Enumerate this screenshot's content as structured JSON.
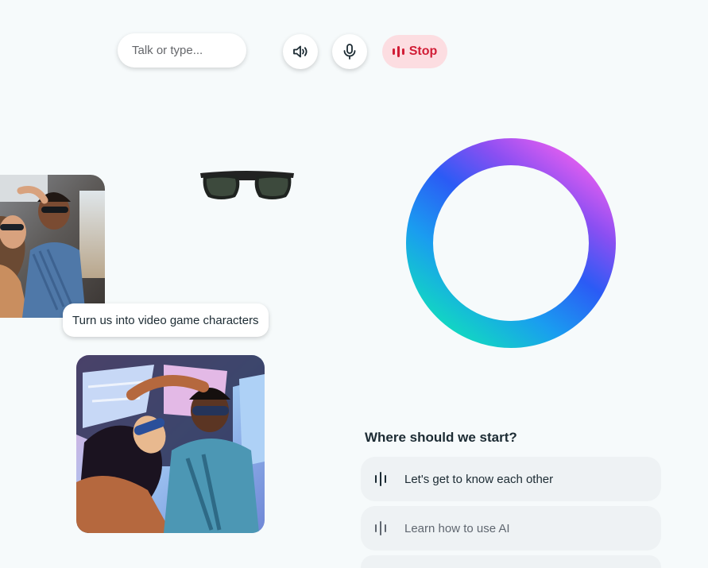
{
  "toolbar": {
    "input_placeholder": "Talk or type...",
    "volume_icon": "speaker-icon",
    "mic_icon": "microphone-icon",
    "stop_label": "Stop",
    "stop_icon": "waveform-icon",
    "colors": {
      "stop_text": "#d11d36",
      "stop_bg": "#fcdde1"
    }
  },
  "showcase": {
    "prompt": "Turn us into video game characters"
  },
  "start": {
    "title": "Where should we start?",
    "suggestions": [
      {
        "label": "Let's get to know each other",
        "icon": "waveform-icon"
      },
      {
        "label": "Learn how to use AI",
        "icon": "waveform-icon"
      }
    ]
  }
}
